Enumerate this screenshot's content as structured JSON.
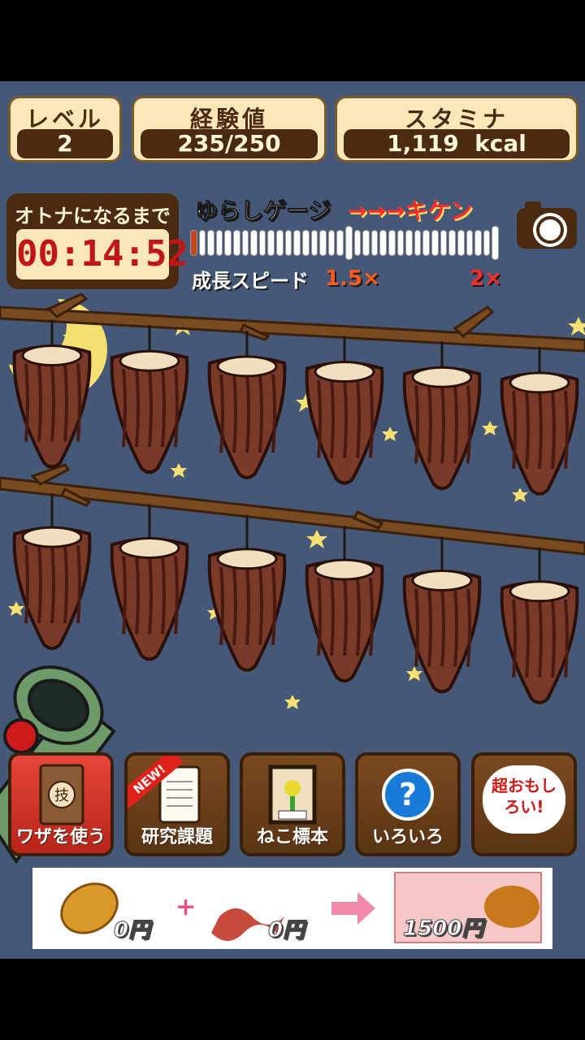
{
  "stats": {
    "level": {
      "label": "レベル",
      "value": "2"
    },
    "exp": {
      "label": "経験値",
      "value": "235/250"
    },
    "stamina": {
      "label": "スタミナ",
      "value": "1,119  kcal"
    }
  },
  "timer": {
    "label": "オトナになるまで",
    "value": "00:14:52"
  },
  "gauge": {
    "title": "ゆらしゲージ",
    "danger_label": "→→→キケン",
    "fill_fraction": 0.02
  },
  "speed": {
    "label": "成長スピード",
    "value1": "1.5×",
    "value2": "2×"
  },
  "icons": {
    "camera": "camera-icon"
  },
  "buttons": [
    {
      "label": "ワザを使う",
      "icon": "skill-book-icon"
    },
    {
      "label": "研究課題",
      "icon": "clipboard-icon",
      "badge": "NEW!"
    },
    {
      "label": "ねこ標本",
      "icon": "cat-specimen-icon"
    },
    {
      "label": "いろいろ",
      "icon": "help-icon"
    },
    {
      "label": "超おもしろい!",
      "icon": "speech-bubble-icon"
    }
  ],
  "ad": {
    "price1": "0円",
    "price2": "0円",
    "price3": "1500円"
  },
  "colors": {
    "sky": "#465877",
    "panel": "#fbe7b8",
    "dark": "#4a2a10",
    "danger": "#ff2a2a"
  }
}
